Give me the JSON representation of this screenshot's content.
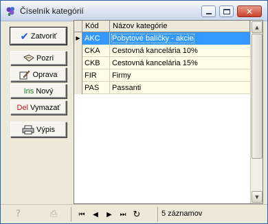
{
  "window": {
    "title": "Číselník kategórií"
  },
  "buttons": {
    "close": {
      "label": "Zatvoriť",
      "icon": "check-icon"
    },
    "view": {
      "label": "Pozri",
      "icon": "glasses-icon"
    },
    "edit": {
      "label": "Oprava",
      "icon": "pencil-icon"
    },
    "new": {
      "prefix": "Ins",
      "label": "Nový"
    },
    "delete": {
      "prefix": "Del",
      "label": "Vymazať"
    },
    "print": {
      "label": "Výpis",
      "icon": "printer-icon"
    }
  },
  "grid": {
    "columns": [
      "Kód",
      "Názov kategórie"
    ],
    "rows": [
      {
        "code": "AKC",
        "name": "Pobytové balíčky - akcie",
        "selected": true
      },
      {
        "code": "CKA",
        "name": "Cestovná kancelária 10%",
        "selected": false
      },
      {
        "code": "CKB",
        "name": "Cestovná kancelária 15%",
        "selected": false
      },
      {
        "code": "FIR",
        "name": "Firmy",
        "selected": false
      },
      {
        "code": "PAS",
        "name": "Passanti",
        "selected": false
      }
    ],
    "row_indicator": "▶"
  },
  "statusbar": {
    "record_count": "5 záznamov"
  },
  "colors": {
    "selection": "#3399ff",
    "row_background": "#fffde6",
    "window_background": "#ece9d8"
  }
}
